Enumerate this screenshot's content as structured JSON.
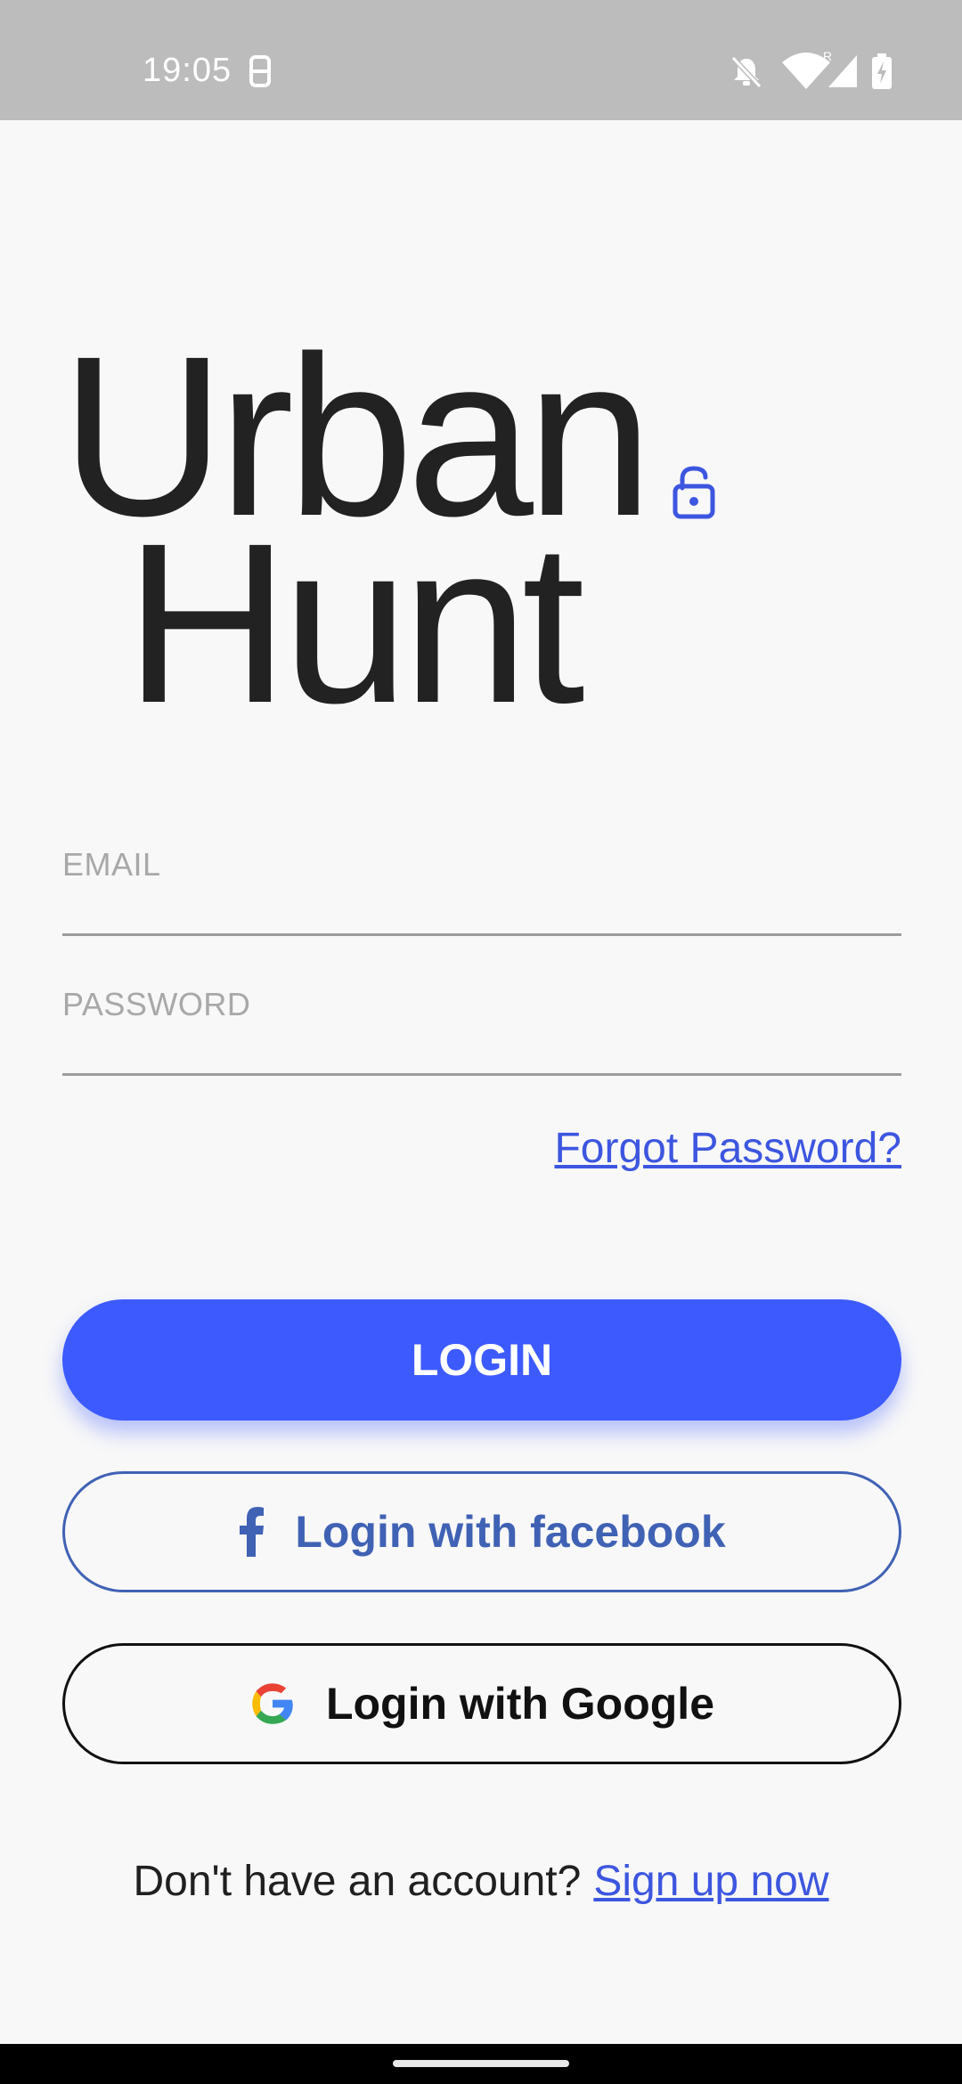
{
  "status_bar": {
    "time": "19:05",
    "icons": [
      "screenshot-icon",
      "bell-off-icon",
      "wifi-icon",
      "signal-icon",
      "battery-charging-icon"
    ]
  },
  "logo": {
    "line1": "Urban",
    "line2": "Hunt",
    "icon": "lock-icon",
    "accent_color": "#3d56e0"
  },
  "form": {
    "email_label": "EMAIL",
    "email_value": "",
    "password_label": "PASSWORD",
    "password_value": "",
    "forgot_password": "Forgot Password?"
  },
  "buttons": {
    "login": "LOGIN",
    "facebook": "Login with facebook",
    "google": "Login with Google"
  },
  "signup": {
    "prompt": "Don't have an account?",
    "link": "Sign up now"
  },
  "colors": {
    "primary": "#3d5afe",
    "facebook": "#4062b4",
    "link": "#3d56e0",
    "background": "#f8f8f8"
  }
}
